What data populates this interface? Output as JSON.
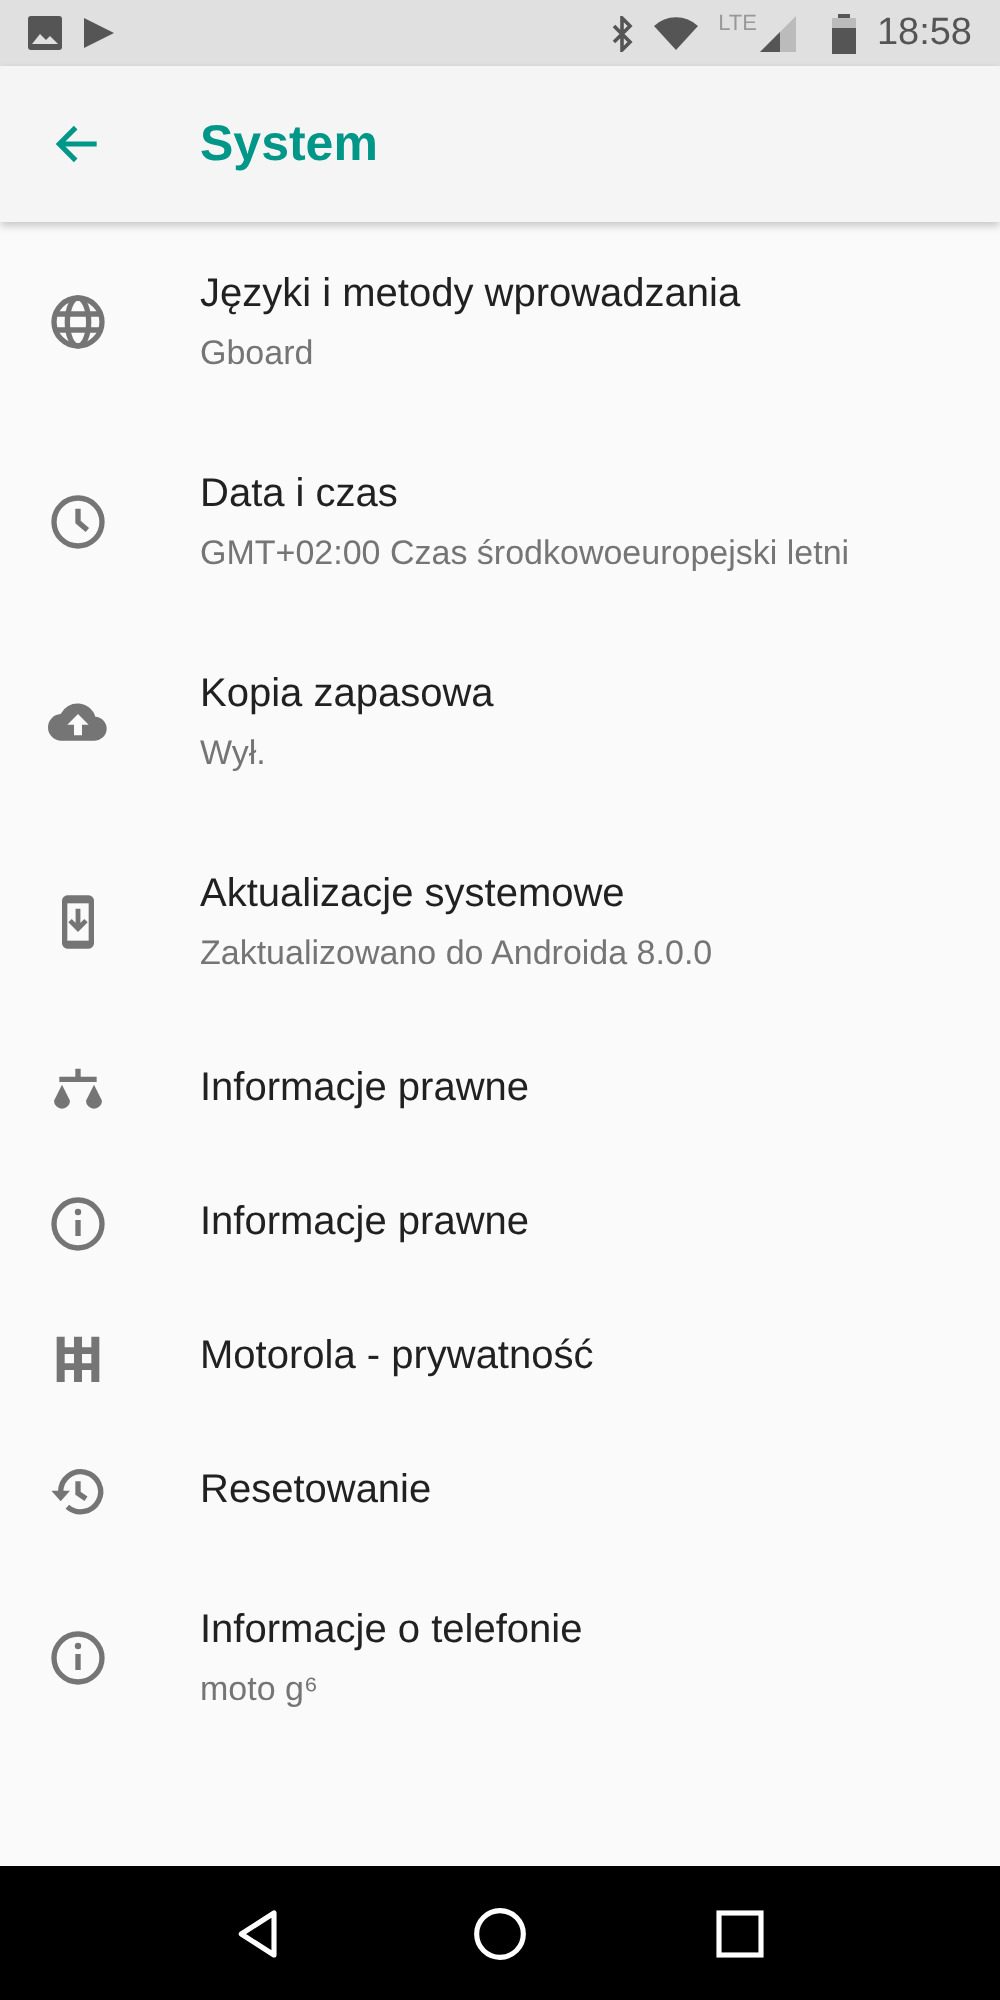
{
  "status_bar": {
    "network": "LTE",
    "time": "18:58"
  },
  "app_bar": {
    "title": "System"
  },
  "items": [
    {
      "title": "Języki i metody wprowadzania",
      "subtitle": "Gboard"
    },
    {
      "title": "Data i czas",
      "subtitle": "GMT+02:00 Czas środkowoeuropejski letni"
    },
    {
      "title": "Kopia zapasowa",
      "subtitle": "Wył."
    },
    {
      "title": "Aktualizacje systemowe",
      "subtitle": "Zaktualizowano do Androida 8.0.0"
    },
    {
      "title": "Informacje prawne"
    },
    {
      "title": "Informacje prawne"
    },
    {
      "title": "Motorola - prywatność"
    },
    {
      "title": "Resetowanie"
    },
    {
      "title": "Informacje o telefonie",
      "subtitle": "moto g⁶"
    }
  ]
}
